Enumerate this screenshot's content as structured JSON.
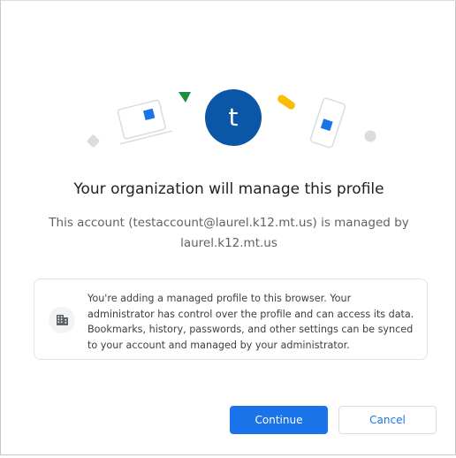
{
  "dialog": {
    "avatar_letter": "t",
    "title": "Your organization will manage this profile",
    "subtitle": "This account (testaccount@laurel.k12.mt.us) is managed by laurel.k12.mt.us",
    "info_text": "You're adding a managed profile to this browser. Your administrator has control over the profile and can access its data. Bookmarks, history, passwords, and other settings can be synced to your account and managed by your administrator.",
    "info_icon": "building-icon"
  },
  "buttons": {
    "continue_label": "Continue",
    "cancel_label": "Cancel"
  },
  "colors": {
    "avatar": "#0b57a7",
    "primary": "#1a73e8",
    "accent_green": "#1e8e3e",
    "accent_yellow": "#fbbc04"
  }
}
